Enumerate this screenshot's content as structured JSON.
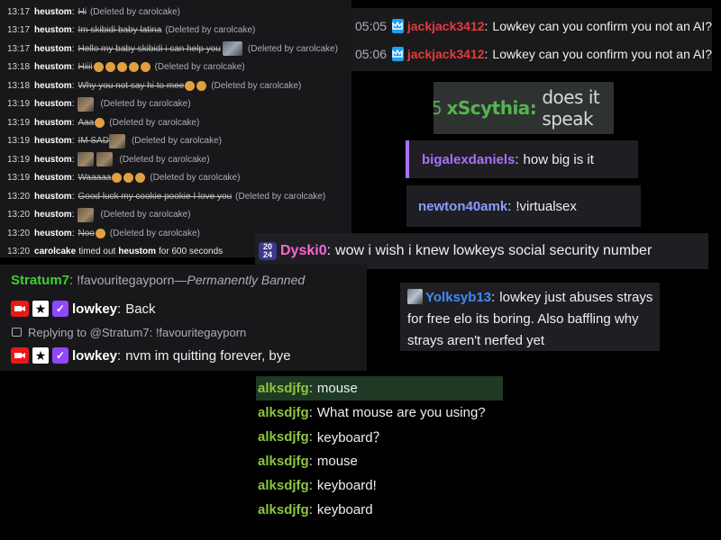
{
  "mod_log": [
    {
      "time": "13:17",
      "user": "heustom",
      "msg": "Hi",
      "deleted": "(Deleted by carolcake)",
      "emotes": 0
    },
    {
      "time": "13:17",
      "user": "heustom",
      "msg": "Im skibidi baby latina",
      "deleted": "(Deleted by carolcake)",
      "emotes": 0
    },
    {
      "time": "13:17",
      "user": "heustom",
      "msg": "Hello my baby skibidi i can help you",
      "deleted": "(Deleted by carolcake)",
      "emotes": 0,
      "gif": "wide"
    },
    {
      "time": "13:18",
      "user": "heustom",
      "msg": "Hiiii",
      "deleted": "(Deleted by carolcake)",
      "emotes": 5
    },
    {
      "time": "13:18",
      "user": "heustom",
      "msg": "Why you not say hi to mee",
      "deleted": "(Deleted by carolcake)",
      "emotes": 2
    },
    {
      "time": "13:19",
      "user": "heustom",
      "msg": "",
      "deleted": "(Deleted by carolcake)",
      "emotes": 0,
      "gif": "single"
    },
    {
      "time": "13:19",
      "user": "heustom",
      "msg": "Aaa",
      "deleted": "(Deleted by carolcake)",
      "emotes": 1
    },
    {
      "time": "13:19",
      "user": "heustom",
      "msg": "IM SAD",
      "deleted": "(Deleted by carolcake)",
      "emotes": 0,
      "gif": "single"
    },
    {
      "time": "13:19",
      "user": "heustom",
      "msg": "",
      "deleted": "(Deleted by carolcake)",
      "emotes": 0,
      "gif": "double"
    },
    {
      "time": "13:19",
      "user": "heustom",
      "msg": "Waaaaa",
      "deleted": "(Deleted by carolcake)",
      "emotes": 3
    },
    {
      "time": "13:20",
      "user": "heustom",
      "msg": "Good luck my cookie pookie I love you",
      "deleted": "(Deleted by carolcake)",
      "emotes": 0
    },
    {
      "time": "13:20",
      "user": "heustom",
      "msg": "",
      "deleted": "(Deleted by carolcake)",
      "emotes": 0,
      "gif": "single"
    },
    {
      "time": "13:20",
      "user": "heustom",
      "msg": "Noo",
      "deleted": "(Deleted by carolcake)",
      "emotes": 1
    }
  ],
  "timeout": {
    "time": "13:20",
    "mod": "carolcake",
    "text_a": "timed out",
    "user": "heustom",
    "text_b": "for 600 seconds"
  },
  "jack": [
    {
      "time": "05:05",
      "user": "jackjack3412",
      "msg": "Lowkey can you confirm you not an AI?"
    },
    {
      "time": "05:06",
      "user": "jackjack3412",
      "msg": "Lowkey can you confirm you not an AI?"
    }
  ],
  "scythia": {
    "prefix": "5",
    "user": "xScythia:",
    "msg": "does it speak"
  },
  "bigalex": {
    "user": "bigalexdaniels",
    "msg": "how big is it"
  },
  "newton": {
    "user": "newton40amk",
    "msg": "!virtualsex"
  },
  "dyski": {
    "badge": "20 24",
    "user": "Dyski0",
    "msg": "wow i wish i knew lowkeys social security number"
  },
  "lowkey_panel": {
    "ban_user": "Stratum7",
    "ban_msg": "!favouritegayporn",
    "ban_dash": "—",
    "ban_status": "Permanently Banned",
    "msg1_user": "lowkey",
    "msg1": "Back",
    "reply_label": "Replying to @Stratum7: !favouritegayporn",
    "msg2_user": "lowkey",
    "msg2": "nvm im quitting forever, bye"
  },
  "yolk": {
    "user": "Yolksyb13",
    "msg": "lowkey just abuses strays for free elo its boring. Also baffling why strays aren't nerfed yet"
  },
  "alk": [
    {
      "user": "alksdjfg",
      "msg": "mouse",
      "highlight": true
    },
    {
      "user": "alksdjfg",
      "msg": "What mouse are you using?",
      "highlight": false
    },
    {
      "user": "alksdjfg",
      "msg": "keyboard？",
      "highlight": false
    },
    {
      "user": "alksdjfg",
      "msg": "mouse",
      "highlight": false
    },
    {
      "user": "alksdjfg",
      "msg": "keyboard!",
      "highlight": false
    },
    {
      "user": "alksdjfg",
      "msg": "keyboard",
      "highlight": false
    }
  ],
  "colors": {
    "bg": "#000000",
    "panel": "#1f1f23",
    "twitch_purple": "#9147ff",
    "jack_red": "#e63b3b",
    "alk_green": "#8cc63f"
  }
}
